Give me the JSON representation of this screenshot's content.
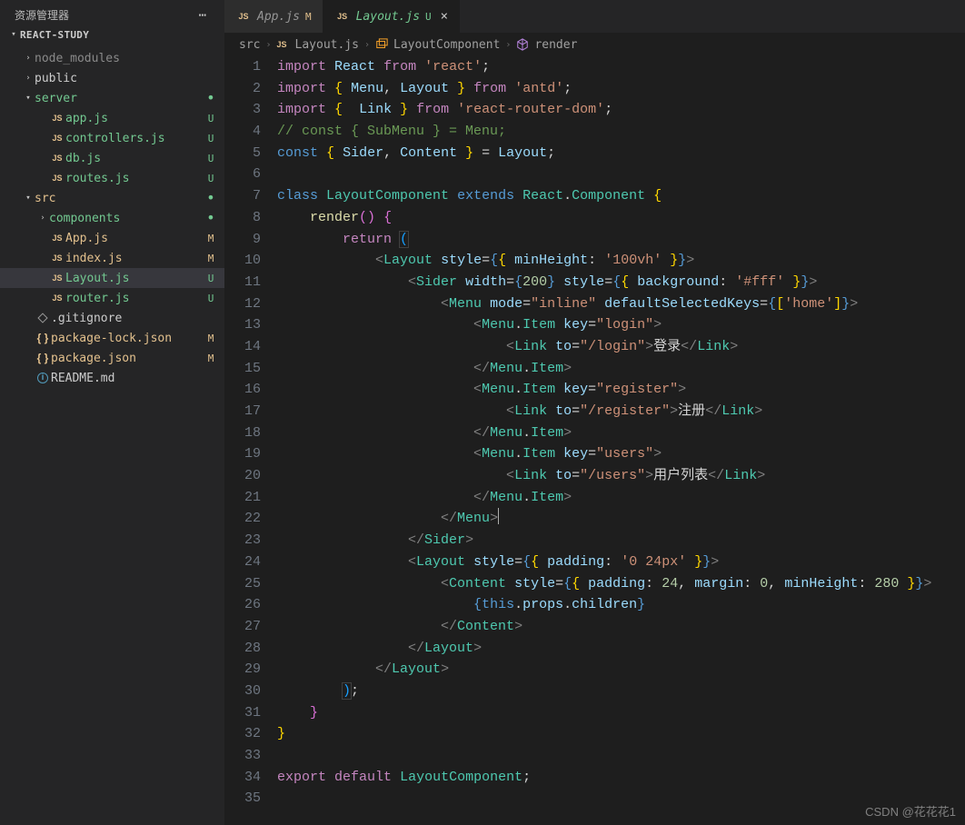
{
  "explorer": {
    "title": "资源管理器",
    "project": "REACT-STUDY",
    "tree": [
      {
        "type": "folder",
        "label": "node_modules",
        "indent": 1,
        "open": false,
        "cls": "dim"
      },
      {
        "type": "folder",
        "label": "public",
        "indent": 1,
        "open": false
      },
      {
        "type": "folder",
        "label": "server",
        "indent": 1,
        "open": true,
        "cls": "grn",
        "status": "dot"
      },
      {
        "type": "js",
        "label": "app.js",
        "indent": 2,
        "cls": "grn",
        "status": "U"
      },
      {
        "type": "js",
        "label": "controllers.js",
        "indent": 2,
        "cls": "grn",
        "status": "U"
      },
      {
        "type": "js",
        "label": "db.js",
        "indent": 2,
        "cls": "grn",
        "status": "U"
      },
      {
        "type": "js",
        "label": "routes.js",
        "indent": 2,
        "cls": "grn",
        "status": "U"
      },
      {
        "type": "folder",
        "label": "src",
        "indent": 1,
        "open": true,
        "cls": "yel",
        "status": "dot"
      },
      {
        "type": "folder",
        "label": "components",
        "indent": 2,
        "open": false,
        "cls": "grn",
        "status": "dot"
      },
      {
        "type": "js",
        "label": "App.js",
        "indent": 2,
        "cls": "yel",
        "status": "M"
      },
      {
        "type": "js",
        "label": "index.js",
        "indent": 2,
        "cls": "yel",
        "status": "M"
      },
      {
        "type": "js",
        "label": "Layout.js",
        "indent": 2,
        "cls": "grn",
        "status": "U",
        "sel": true
      },
      {
        "type": "js",
        "label": "router.js",
        "indent": 2,
        "cls": "grn",
        "status": "U"
      },
      {
        "type": "git",
        "label": ".gitignore",
        "indent": 1
      },
      {
        "type": "json",
        "label": "package-lock.json",
        "indent": 1,
        "cls": "yel",
        "status": "M"
      },
      {
        "type": "json",
        "label": "package.json",
        "indent": 1,
        "cls": "yel",
        "status": "M"
      },
      {
        "type": "md",
        "label": "README.md",
        "indent": 1
      }
    ]
  },
  "tabs": [
    {
      "icon": "js",
      "name": "App.js",
      "status": "M",
      "active": false
    },
    {
      "icon": "js",
      "name": "Layout.js",
      "status": "U",
      "active": true,
      "close": true
    }
  ],
  "breadcrumb": [
    {
      "text": "src"
    },
    {
      "icon": "js",
      "text": "Layout.js"
    },
    {
      "icon": "class",
      "text": "LayoutComponent"
    },
    {
      "icon": "cube",
      "text": "render"
    }
  ],
  "lines": 35,
  "code": [
    "<span class='k-pur'>import</span> <span class='k-var'>React</span> <span class='k-pur'>from</span> <span class='k-str'>'react'</span>;",
    "<span class='k-pur'>import</span> <span class='k-br3'>{</span> <span class='k-var'>Menu</span>, <span class='k-var'>Layout</span> <span class='k-br3'>}</span> <span class='k-pur'>from</span> <span class='k-str'>'antd'</span>;",
    "<span class='k-pur'>import</span> <span class='k-br3'>{</span>  <span class='k-var'>Link</span> <span class='k-br3'>}</span> <span class='k-pur'>from</span> <span class='k-str'>'react-router-dom'</span>;",
    "<span class='k-com'>// const { SubMenu } = Menu;</span>",
    "<span class='k-blu'>const</span> <span class='k-br3'>{</span> <span class='k-var'>Sider</span>, <span class='k-var'>Content</span> <span class='k-br3'>}</span> = <span class='k-var'>Layout</span>;",
    "",
    "<span class='k-blu'>class</span> <span class='k-grn'>LayoutComponent</span> <span class='k-blu'>extends</span> <span class='k-grn'>React</span>.<span class='k-grn'>Component</span> <span class='k-br3'>{</span>",
    "    <span class='k-yel'>render</span><span class='k-brc'>()</span> <span class='k-brc'>{</span>",
    "        <span class='k-pur'>return</span> <span class='k-br2' style='outline:1px solid #404040'>(</span>",
    "            <span class='k-gry'>&lt;</span><span class='k-grn'>Layout</span> <span class='k-var'>style</span>=<span class='k-blu'>{</span><span class='k-br3'>{</span> <span class='k-var'>minHeight</span><span class='k-wht'>:</span> <span class='k-str'>'100vh'</span> <span class='k-br3'>}</span><span class='k-blu'>}</span><span class='k-gry'>&gt;</span>",
    "                <span class='k-gry'>&lt;</span><span class='k-grn'>Sider</span> <span class='k-var'>width</span>=<span class='k-blu'>{</span><span class='k-num'>200</span><span class='k-blu'>}</span> <span class='k-var'>style</span>=<span class='k-blu'>{</span><span class='k-br3'>{</span> <span class='k-var'>background</span><span class='k-wht'>:</span> <span class='k-str'>'#fff'</span> <span class='k-br3'>}</span><span class='k-blu'>}</span><span class='k-gry'>&gt;</span>",
    "                    <span class='k-gry'>&lt;</span><span class='k-grn'>Menu</span> <span class='k-var'>mode</span>=<span class='k-str'>\"inline\"</span> <span class='k-var'>defaultSelectedKeys</span>=<span class='k-blu'>{</span><span class='k-br3'>[</span><span class='k-str'>'home'</span><span class='k-br3'>]</span><span class='k-blu'>}</span><span class='k-gry'>&gt;</span>",
    "                        <span class='k-gry'>&lt;</span><span class='k-grn'>Menu</span><span class='k-wht'>.</span><span class='k-grn'>Item</span> <span class='k-var'>key</span>=<span class='k-str'>\"login\"</span><span class='k-gry'>&gt;</span>",
    "                            <span class='k-gry'>&lt;</span><span class='k-grn'>Link</span> <span class='k-var'>to</span>=<span class='k-str'>\"/login\"</span><span class='k-gry'>&gt;</span><span class='k-wht'>登录</span><span class='k-gry'>&lt;/</span><span class='k-grn'>Link</span><span class='k-gry'>&gt;</span>",
    "                        <span class='k-gry'>&lt;/</span><span class='k-grn'>Menu</span><span class='k-wht'>.</span><span class='k-grn'>Item</span><span class='k-gry'>&gt;</span>",
    "                        <span class='k-gry'>&lt;</span><span class='k-grn'>Menu</span><span class='k-wht'>.</span><span class='k-grn'>Item</span> <span class='k-var'>key</span>=<span class='k-str'>\"register\"</span><span class='k-gry'>&gt;</span>",
    "                            <span class='k-gry'>&lt;</span><span class='k-grn'>Link</span> <span class='k-var'>to</span>=<span class='k-str'>\"/register\"</span><span class='k-gry'>&gt;</span><span class='k-wht'>注册</span><span class='k-gry'>&lt;/</span><span class='k-grn'>Link</span><span class='k-gry'>&gt;</span>",
    "                        <span class='k-gry'>&lt;/</span><span class='k-grn'>Menu</span><span class='k-wht'>.</span><span class='k-grn'>Item</span><span class='k-gry'>&gt;</span>",
    "                        <span class='k-gry'>&lt;</span><span class='k-grn'>Menu</span><span class='k-wht'>.</span><span class='k-grn'>Item</span> <span class='k-var'>key</span>=<span class='k-str'>\"users\"</span><span class='k-gry'>&gt;</span>",
    "                            <span class='k-gry'>&lt;</span><span class='k-grn'>Link</span> <span class='k-var'>to</span>=<span class='k-str'>\"/users\"</span><span class='k-gry'>&gt;</span><span class='k-wht'>用户列表</span><span class='k-gry'>&lt;/</span><span class='k-grn'>Link</span><span class='k-gry'>&gt;</span>",
    "                        <span class='k-gry'>&lt;/</span><span class='k-grn'>Menu</span><span class='k-wht'>.</span><span class='k-grn'>Item</span><span class='k-gry'>&gt;</span>",
    "                    <span class='k-gry'>&lt;/</span><span class='k-grn'>Menu</span><span class='k-gry'>&gt;</span><span class='cursor'></span>",
    "                <span class='k-gry'>&lt;/</span><span class='k-grn'>Sider</span><span class='k-gry'>&gt;</span>",
    "                <span class='k-gry'>&lt;</span><span class='k-grn'>Layout</span> <span class='k-var'>style</span>=<span class='k-blu'>{</span><span class='k-br3'>{</span> <span class='k-var'>padding</span><span class='k-wht'>:</span> <span class='k-str'>'0 24px'</span> <span class='k-br3'>}</span><span class='k-blu'>}</span><span class='k-gry'>&gt;</span>",
    "                    <span class='k-gry'>&lt;</span><span class='k-grn'>Content</span> <span class='k-var'>style</span>=<span class='k-blu'>{</span><span class='k-br3'>{</span> <span class='k-var'>padding</span><span class='k-wht'>:</span> <span class='k-num'>24</span>, <span class='k-var'>margin</span><span class='k-wht'>:</span> <span class='k-num'>0</span>, <span class='k-var'>minHeight</span><span class='k-wht'>:</span> <span class='k-num'>280</span> <span class='k-br3'>}</span><span class='k-blu'>}</span><span class='k-gry'>&gt;</span>",
    "                        <span class='k-blu'>{</span><span class='k-blu'>this</span>.<span class='k-var'>props</span>.<span class='k-var'>children</span><span class='k-blu'>}</span>",
    "                    <span class='k-gry'>&lt;/</span><span class='k-grn'>Content</span><span class='k-gry'>&gt;</span>",
    "                <span class='k-gry'>&lt;/</span><span class='k-grn'>Layout</span><span class='k-gry'>&gt;</span>",
    "            <span class='k-gry'>&lt;/</span><span class='k-grn'>Layout</span><span class='k-gry'>&gt;</span>",
    "        <span class='k-br2' style='outline:1px solid #404040'>)</span>;",
    "    <span class='k-brc'>}</span>",
    "<span class='k-br3'>}</span>",
    "",
    "<span class='k-pur'>export</span> <span class='k-pur'>default</span> <span class='k-grn'>LayoutComponent</span>;",
    ""
  ],
  "watermark": "CSDN @花花花1"
}
